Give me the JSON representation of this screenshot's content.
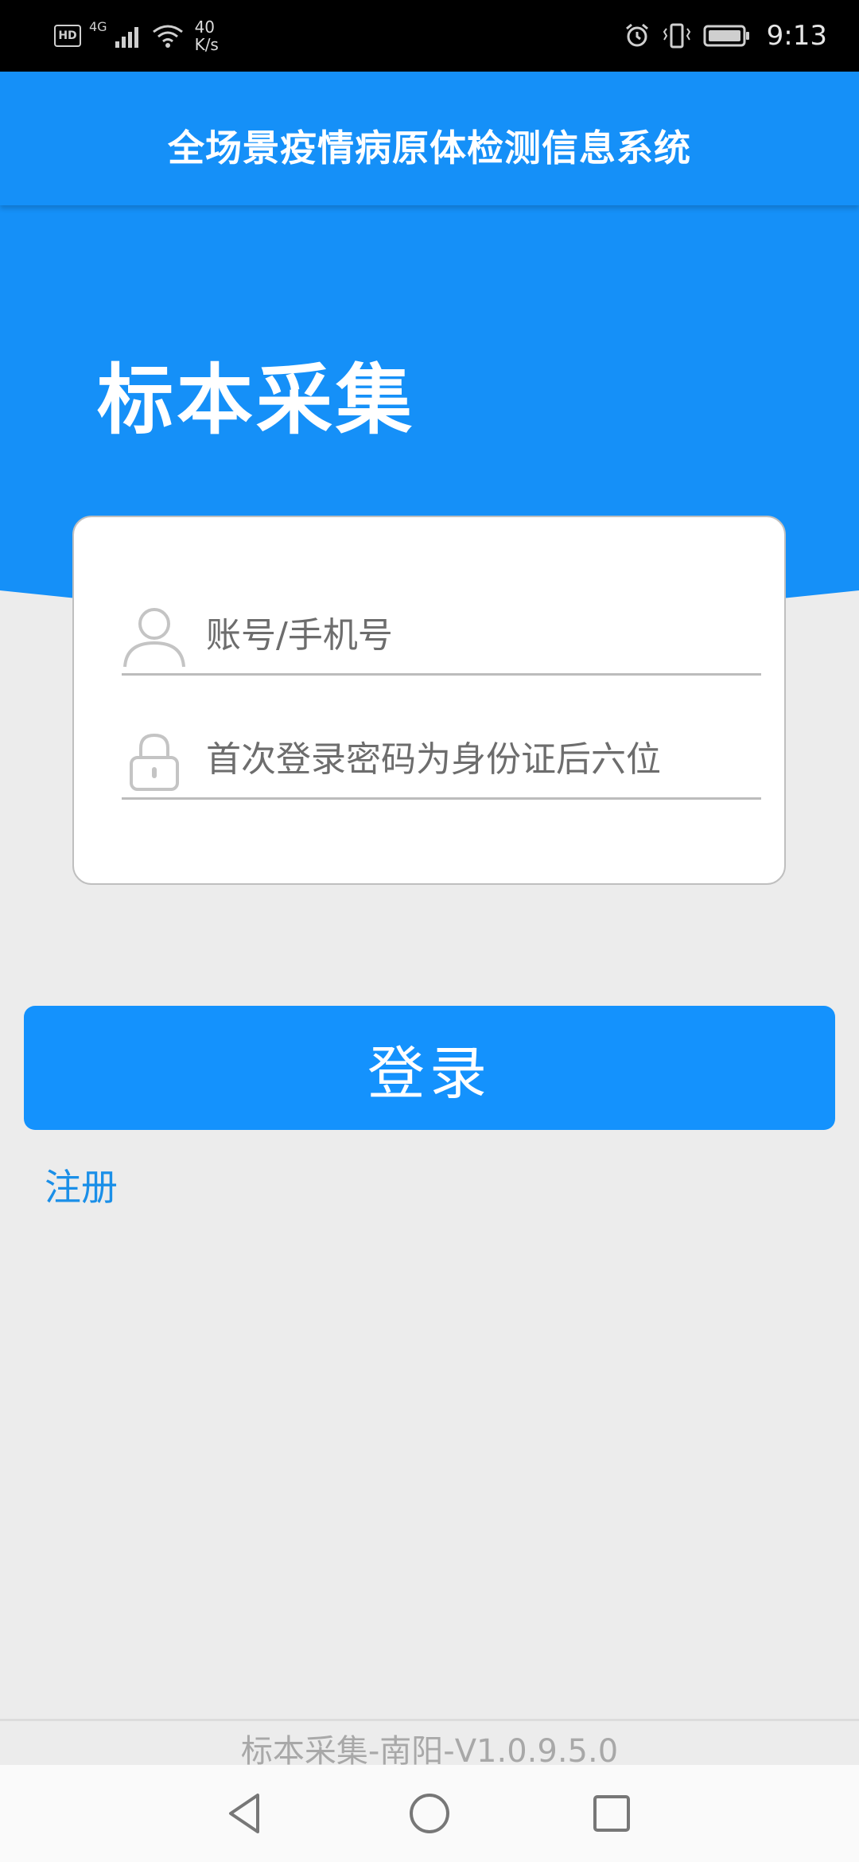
{
  "status_bar": {
    "hd": "HD",
    "network": "4G",
    "speed_value": "40",
    "speed_unit": "K/s",
    "time": "9:13"
  },
  "header": {
    "title": "全场景疫情病原体检测信息系统",
    "hero_title": "标本采集",
    "background_color": "#1590f8"
  },
  "login": {
    "account_placeholder": "账号/手机号",
    "password_placeholder": "首次登录密码为身份证后六位",
    "login_label": "登录",
    "register_label": "注册"
  },
  "footer": {
    "version": "标本采集-南阳-V1.0.9.5.0"
  },
  "icons": {
    "account": "user-icon",
    "password": "lock-icon",
    "nav_back": "back-triangle-icon",
    "nav_home": "home-circle-icon",
    "nav_recent": "recent-square-icon"
  }
}
